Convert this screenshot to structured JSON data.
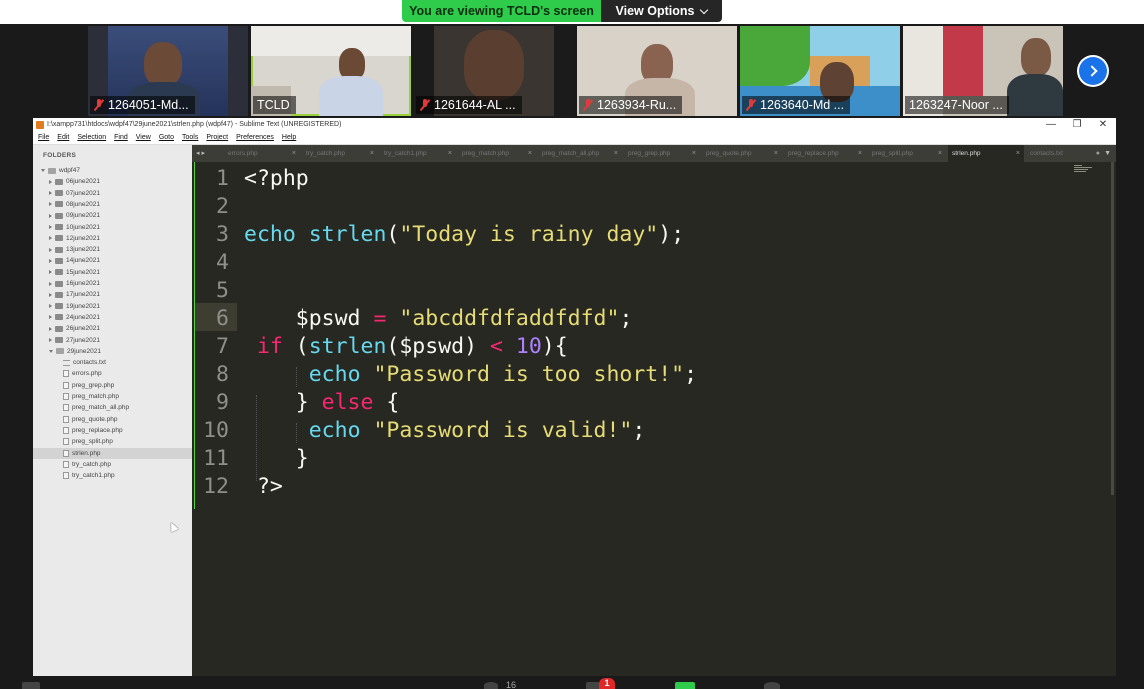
{
  "share_banner": {
    "viewing_text": "You are viewing TCLD's screen",
    "view_options_label": "View Options"
  },
  "participants": [
    {
      "name": "1264051-Md...",
      "muted": true
    },
    {
      "name": "TCLD",
      "muted": false
    },
    {
      "name": "1261644-AL ...",
      "muted": true
    },
    {
      "name": "1263934-Ru...",
      "muted": true
    },
    {
      "name": "1263640-Md ...",
      "muted": true
    },
    {
      "name": "1263247-Noor ...",
      "muted": false
    }
  ],
  "sublime": {
    "title": "I:\\xampp731\\htdocs\\wdpf47\\29june2021\\strlen.php (wdpf47) - Sublime Text (UNREGISTERED)",
    "window_controls": {
      "minimize": "—",
      "restore": "❐",
      "close": "✕"
    },
    "menu": [
      "File",
      "Edit",
      "Selection",
      "Find",
      "View",
      "Goto",
      "Tools",
      "Project",
      "Preferences",
      "Help"
    ],
    "sidebar": {
      "header": "FOLDERS",
      "root": "wdpf47",
      "folders": [
        "06june2021",
        "07june2021",
        "08june2021",
        "09june2021",
        "10june2021",
        "12june2021",
        "13june2021",
        "14june2021",
        "15june2021",
        "16june2021",
        "17june2021",
        "19june2021",
        "24june2021",
        "26june2021",
        "27june2021",
        "29june2021"
      ],
      "files": [
        "contacts.txt",
        "errors.php",
        "preg_grep.php",
        "preg_match.php",
        "preg_match_all.php",
        "preg_quote.php",
        "preg_replace.php",
        "preg_split.php",
        "strlen.php",
        "try_catch.php",
        "try_catch1.php"
      ],
      "selected_file": "strlen.php"
    },
    "tabs": [
      "errors.php",
      "try_catch.php",
      "try_catch1.php",
      "preg_match.php",
      "preg_match_all.php",
      "preg_grep.php",
      "preg_quote.php",
      "preg_replace.php",
      "preg_split.php",
      "strlen.php",
      "contacts.txt"
    ],
    "active_tab": "strlen.php",
    "current_line": 6,
    "code_line_numbers": [
      "1",
      "2",
      "3",
      "4",
      "5",
      "6",
      "7",
      "8",
      "9",
      "10",
      "11",
      "12"
    ]
  },
  "toolbar": {
    "participant_count": "16",
    "chat_badge": "1"
  }
}
